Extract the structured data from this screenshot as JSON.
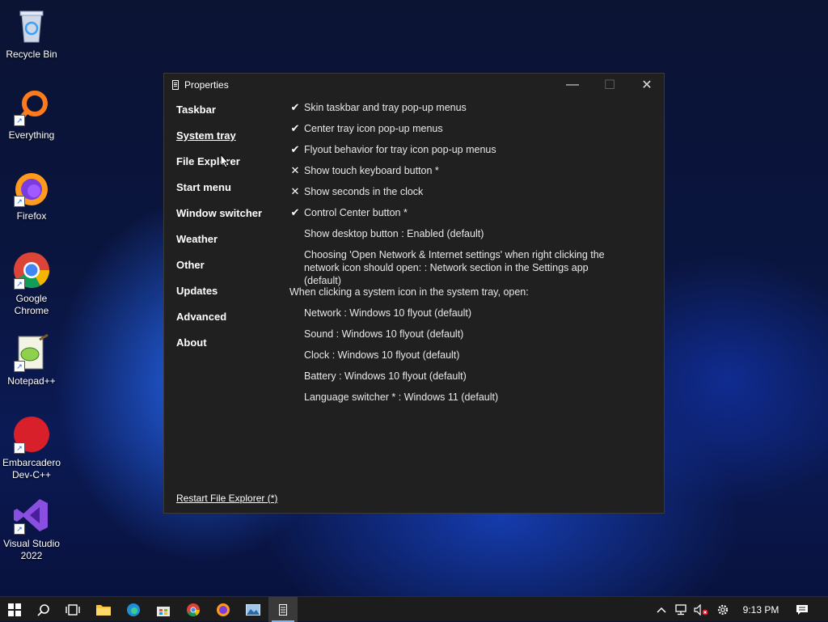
{
  "desktop": {
    "icons": [
      {
        "label": "Recycle Bin"
      },
      {
        "label": "Everything"
      },
      {
        "label": "Firefox"
      },
      {
        "label": "Google Chrome"
      },
      {
        "label": "Notepad++"
      },
      {
        "label": "Embarcadero Dev-C++"
      },
      {
        "label": "Visual Studio 2022"
      }
    ]
  },
  "window": {
    "title": "Properties",
    "minimize_glyph": "—",
    "maximize_glyph": "☐",
    "close_glyph": "✕"
  },
  "nav": {
    "items": [
      {
        "label": "Taskbar"
      },
      {
        "label": "System tray",
        "active": true
      },
      {
        "label": "File Explorer"
      },
      {
        "label": "Start menu"
      },
      {
        "label": "Window switcher"
      },
      {
        "label": "Weather"
      },
      {
        "label": "Other"
      },
      {
        "label": "Updates"
      },
      {
        "label": "Advanced"
      },
      {
        "label": "About"
      }
    ]
  },
  "settings": {
    "check_glyph": "✔",
    "cross_glyph": "✕",
    "rows": [
      {
        "mark": "✔",
        "text": "Skin taskbar and tray pop-up menus"
      },
      {
        "mark": "✔",
        "text": "Center tray icon pop-up menus"
      },
      {
        "mark": "✔",
        "text": "Flyout behavior for tray icon pop-up menus"
      },
      {
        "mark": "✕",
        "text": "Show touch keyboard button *"
      },
      {
        "mark": "✕",
        "text": "Show seconds in the clock"
      },
      {
        "mark": "✔",
        "text": "Control Center button *"
      },
      {
        "mark": "",
        "text": "Show desktop button : Enabled (default)"
      },
      {
        "mark": "",
        "text": "Choosing 'Open Network & Internet settings' when right clicking the network icon should open: : Network section in the Settings app (default)"
      }
    ],
    "section_heading": "When clicking a system icon in the system tray, open:",
    "sub_rows": [
      {
        "text": "Network : Windows 10 flyout (default)"
      },
      {
        "text": "Sound : Windows 10 flyout (default)"
      },
      {
        "text": "Clock : Windows 10 flyout (default)"
      },
      {
        "text": "Battery : Windows 10 flyout (default)"
      },
      {
        "text": "Language switcher * : Windows 11 (default)"
      }
    ]
  },
  "footer": {
    "restart_link": "Restart File Explorer (*)"
  },
  "taskbar": {
    "apps": [
      "start-icon",
      "search-icon",
      "task-view-icon",
      "file-explorer-icon",
      "edge-icon",
      "store-icon",
      "chrome-icon",
      "firefox-icon",
      "photos-icon",
      "properties-app-icon"
    ],
    "clock": "9:13 PM",
    "tray_arrow": "^"
  },
  "colors": {
    "window_bg": "#202020",
    "taskbar_bg": "#1c1c1c",
    "accent": "#7ab7ff"
  }
}
